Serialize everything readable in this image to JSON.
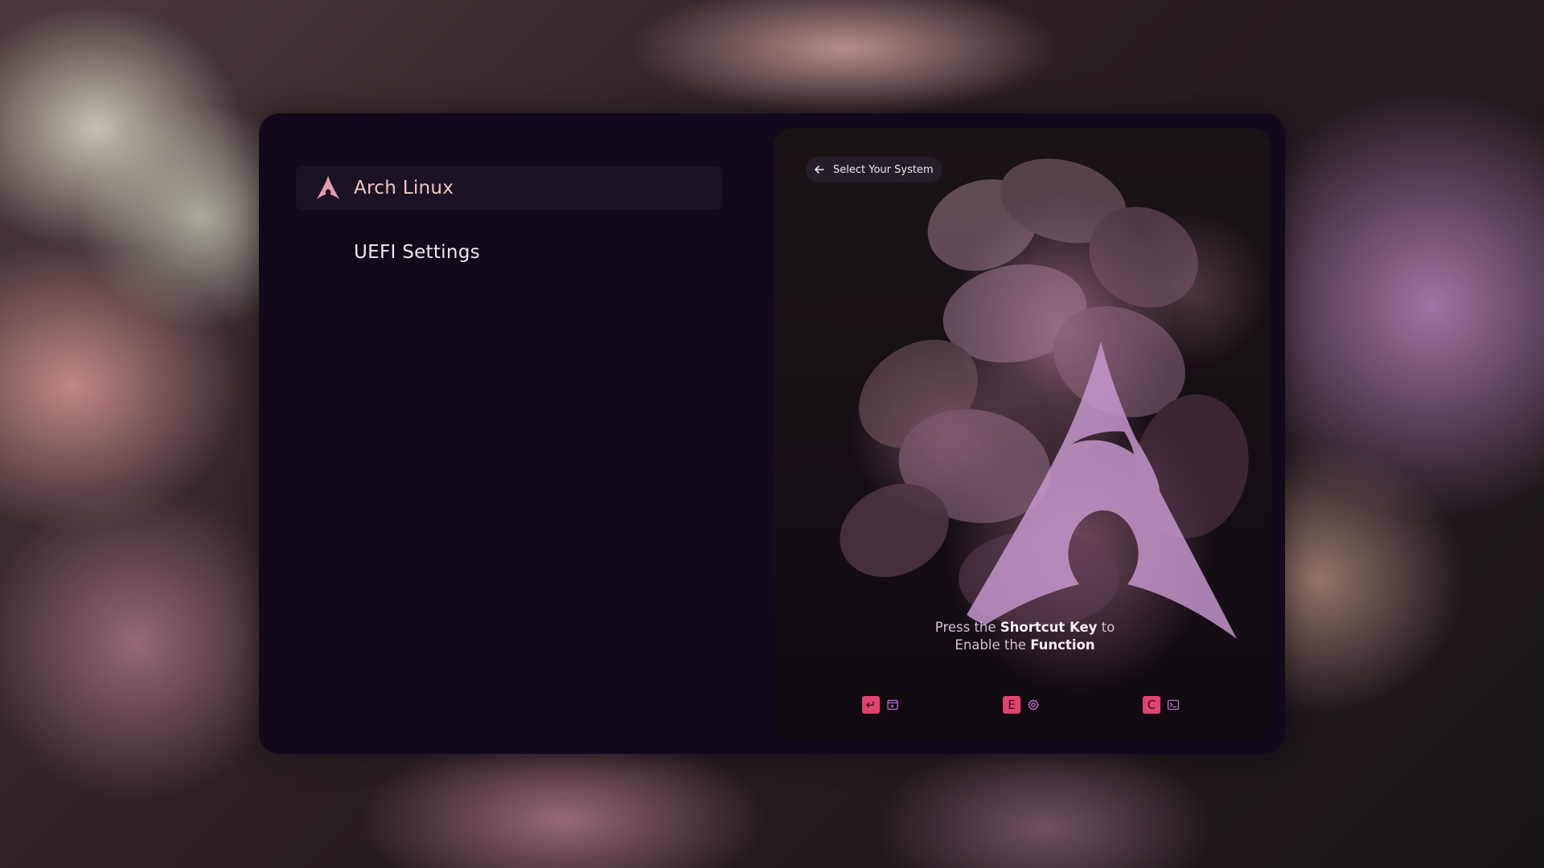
{
  "menu": {
    "entries": [
      {
        "label": "Arch Linux",
        "icon": "arch-logo-icon",
        "selected": true
      },
      {
        "label": "UEFI Settings",
        "icon": "",
        "selected": false
      }
    ]
  },
  "panel": {
    "back_label": "Select Your System",
    "hint": {
      "part1": "Press the ",
      "bold1": "Shortcut Key",
      "part2": " to",
      "part3": "Enable the ",
      "bold2": "Function"
    },
    "shortcuts": [
      {
        "key": "↵",
        "key_name": "enter",
        "icon": "boot-window-icon"
      },
      {
        "key": "E",
        "key_name": "e",
        "icon": "gear-icon"
      },
      {
        "key": "C",
        "key_name": "c",
        "icon": "terminal-icon"
      }
    ]
  },
  "colors": {
    "accent": "#e0446e",
    "window": "#120a1a",
    "selected_row": "#1b1323",
    "selected_text": "#ecc6c4",
    "logo": "#c89ad0"
  }
}
